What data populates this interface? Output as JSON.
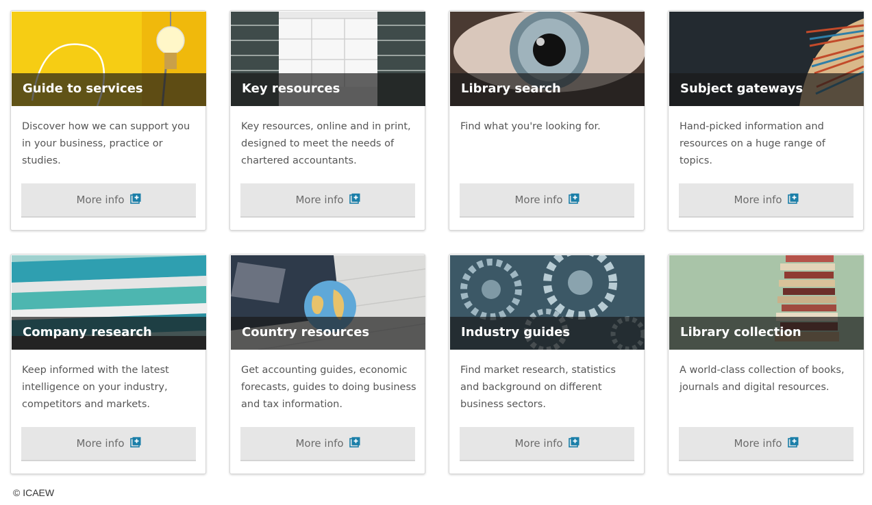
{
  "cards": [
    {
      "title": "Guide to services",
      "description": "Discover how we can support you in your business, practice or studies.",
      "button_label": "More info",
      "image_icon": "lightbulb-image"
    },
    {
      "title": "Key resources",
      "description": "Key resources, online and in print, designed to meet the needs of chartered accountants.",
      "button_label": "More info",
      "image_icon": "library-shelves-image"
    },
    {
      "title": "Library search",
      "description": "Find what you're looking for.",
      "button_label": "More info",
      "image_icon": "eye-image"
    },
    {
      "title": "Subject gateways",
      "description": "Hand-picked information and resources on a huge range of topics.",
      "button_label": "More info",
      "image_icon": "open-book-image"
    },
    {
      "title": "Company research",
      "description": "Keep informed with the latest intelligence on your industry, competitors and markets.",
      "button_label": "More info",
      "image_icon": "stacked-files-image"
    },
    {
      "title": "Country resources",
      "description": "Get accounting guides, economic forecasts, guides to doing business and tax information.",
      "button_label": "More info",
      "image_icon": "globe-passport-image"
    },
    {
      "title": "Industry guides",
      "description": "Find market research, statistics and background on different business sectors.",
      "button_label": "More info",
      "image_icon": "gears-image"
    },
    {
      "title": "Library collection",
      "description": "A world-class collection of books, journals and digital resources.",
      "button_label": "More info",
      "image_icon": "book-stack-image"
    }
  ],
  "footer": {
    "copyright": "© ICAEW"
  },
  "colors": {
    "button_icon": "#1a7ea8",
    "banner": "#191919",
    "button_bg": "#e6e6e6"
  }
}
